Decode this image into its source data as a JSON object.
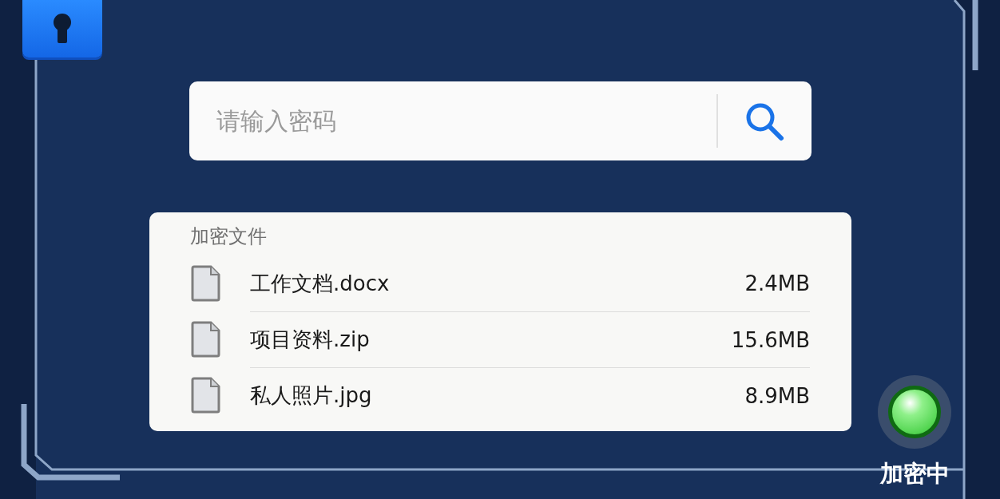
{
  "search": {
    "placeholder": "请输入密码"
  },
  "files_panel": {
    "title": "加密文件",
    "files": [
      {
        "name": "工作文档.docx",
        "size": "2.4MB"
      },
      {
        "name": "项目资料.zip",
        "size": "15.6MB"
      },
      {
        "name": "私人照片.jpg",
        "size": "8.9MB"
      }
    ]
  },
  "status": {
    "label": "加密中",
    "on": true
  }
}
